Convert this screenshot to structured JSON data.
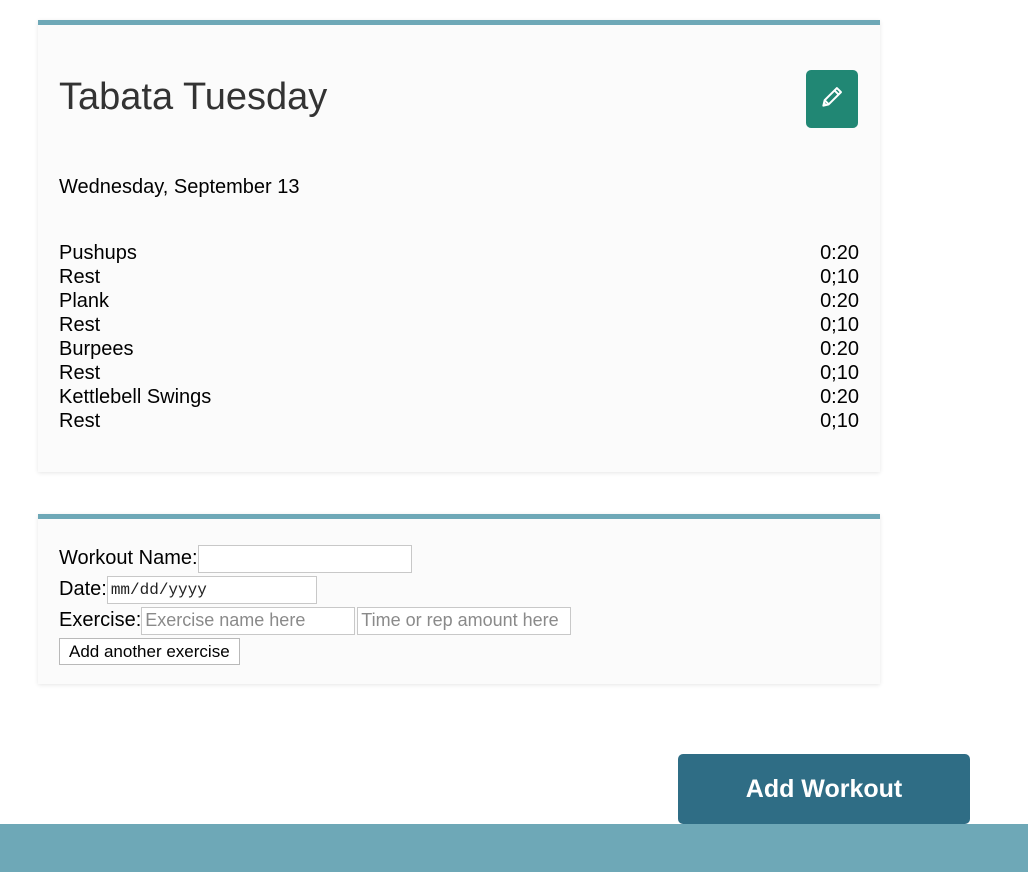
{
  "workout": {
    "title": "Tabata Tuesday",
    "date": "Wednesday, September 13",
    "edit_icon": "pencil-icon",
    "edit_button_color": "#218774",
    "exercises": [
      {
        "name": "Pushups",
        "time": "0:20"
      },
      {
        "name": "Rest",
        "time": "0;10"
      },
      {
        "name": "Plank",
        "time": "0:20"
      },
      {
        "name": "Rest",
        "time": "0;10"
      },
      {
        "name": "Burpees",
        "time": "0:20"
      },
      {
        "name": "Rest",
        "time": "0;10"
      },
      {
        "name": "Kettlebell Swings",
        "time": "0:20"
      },
      {
        "name": "Rest",
        "time": "0;10"
      }
    ]
  },
  "form": {
    "name_label": "Workout Name:",
    "name_value": "",
    "date_label": "Date:",
    "date_placeholder": "mm/dd/yyyy",
    "exercise_label": "Exercise:",
    "exercise_placeholder": "Exercise name here",
    "time_placeholder": "Time or rep amount here",
    "add_exercise_label": "Add another exercise"
  },
  "actions": {
    "add_workout_label": "Add Workout",
    "add_workout_color": "#2f6d85"
  },
  "theme": {
    "accent": "#6ea8b7"
  }
}
